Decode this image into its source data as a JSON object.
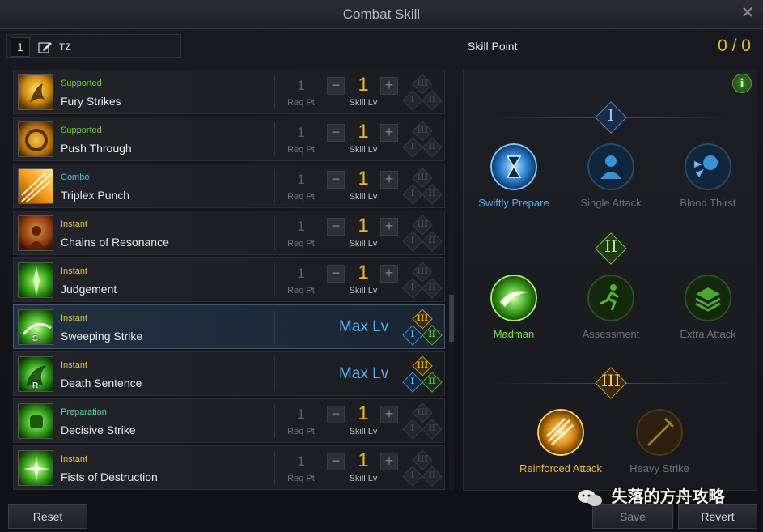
{
  "window": {
    "title": "Combat Skill"
  },
  "preset": {
    "number": "1",
    "name": "TZ"
  },
  "skill_point": {
    "label": "Skill Point",
    "value": "0 / 0"
  },
  "columns": {
    "req_label": "Req Pt",
    "lv_label": "Skill Lv",
    "max_label": "Max Lv"
  },
  "tripod_numerals": {
    "i": "I",
    "ii": "II",
    "iii": "III"
  },
  "skills": [
    {
      "type": "Supported",
      "name": "Fury Strikes",
      "req": "1",
      "lv": "1",
      "max": false,
      "key": ""
    },
    {
      "type": "Supported",
      "name": "Push Through",
      "req": "1",
      "lv": "1",
      "max": false,
      "key": ""
    },
    {
      "type": "Combo",
      "name": "Triplex Punch",
      "req": "1",
      "lv": "1",
      "max": false,
      "key": ""
    },
    {
      "type": "Instant",
      "name": "Chains of Resonance",
      "req": "1",
      "lv": "1",
      "max": false,
      "key": ""
    },
    {
      "type": "Instant",
      "name": "Judgement",
      "req": "1",
      "lv": "1",
      "max": false,
      "key": ""
    },
    {
      "type": "Instant",
      "name": "Sweeping Strike",
      "req": "",
      "lv": "",
      "max": true,
      "key": "S"
    },
    {
      "type": "Instant",
      "name": "Death Sentence",
      "req": "",
      "lv": "",
      "max": true,
      "key": "R"
    },
    {
      "type": "Preparation",
      "name": "Decisive Strike",
      "req": "1",
      "lv": "1",
      "max": false,
      "key": ""
    },
    {
      "type": "Instant",
      "name": "Fists of Destruction",
      "req": "1",
      "lv": "1",
      "max": false,
      "key": ""
    }
  ],
  "tripod_tiers": [
    {
      "numeral": "I",
      "options": [
        {
          "label": "Swiftly Prepare",
          "active": true,
          "color": "#4db2ff"
        },
        {
          "label": "Single Attack",
          "active": false
        },
        {
          "label": "Blood Thirst",
          "active": false
        }
      ]
    },
    {
      "numeral": "II",
      "options": [
        {
          "label": "Madman",
          "active": true,
          "color": "#7be052"
        },
        {
          "label": "Assessment",
          "active": false
        },
        {
          "label": "Extra Attack",
          "active": false
        }
      ]
    },
    {
      "numeral": "III",
      "options": [
        {
          "label": "Reinforced Attack",
          "active": true,
          "color": "#f2b22a"
        },
        {
          "label": "Heavy Strike",
          "active": false
        }
      ]
    }
  ],
  "buttons": {
    "reset": "Reset",
    "save": "Save",
    "revert": "Revert"
  },
  "watermark": "失落的方舟攻略",
  "colors": {
    "accent_gold": "#f2b22a",
    "accent_blue": "#4db2ff",
    "accent_green": "#7be052"
  }
}
